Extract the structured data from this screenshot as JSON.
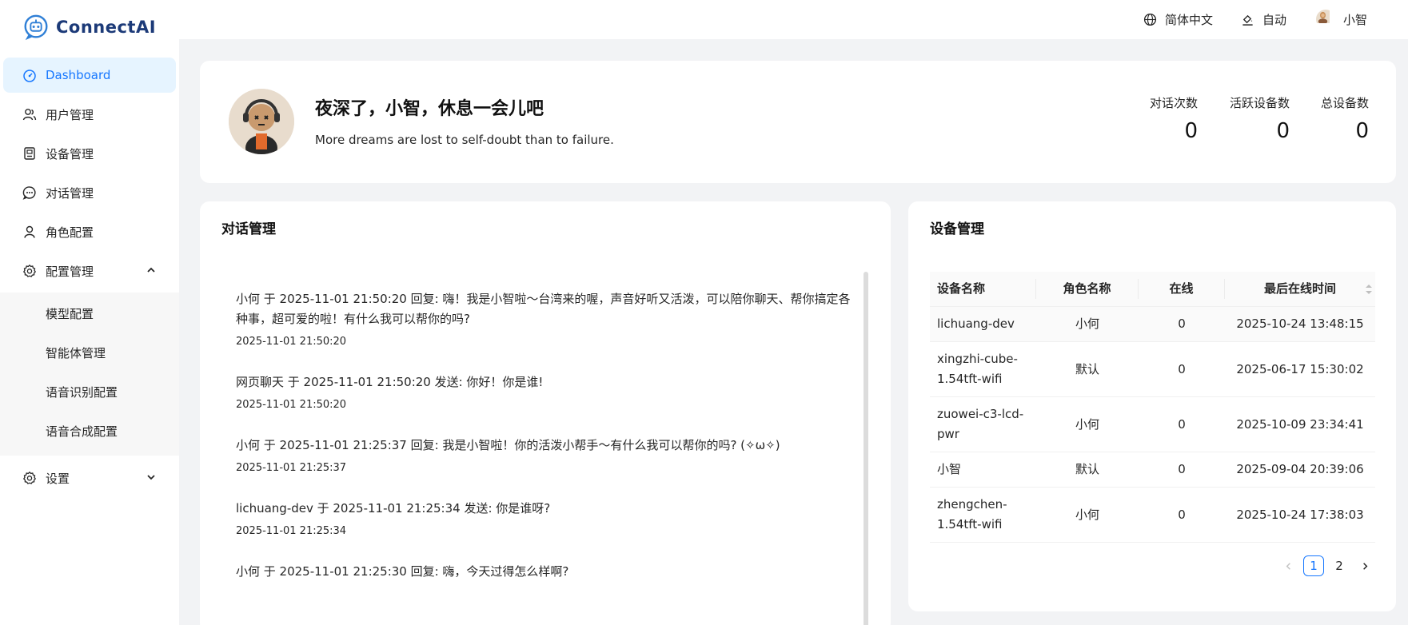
{
  "brand": {
    "name": "ConnectAI"
  },
  "sidebar": {
    "items": [
      {
        "label": "Dashboard",
        "icon": "dashboard-icon",
        "active": true
      },
      {
        "label": "用户管理",
        "icon": "users-icon"
      },
      {
        "label": "设备管理",
        "icon": "device-icon"
      },
      {
        "label": "对话管理",
        "icon": "chat-icon"
      },
      {
        "label": "角色配置",
        "icon": "user-icon"
      },
      {
        "label": "配置管理",
        "icon": "gear-icon",
        "expanded": true
      }
    ],
    "submenu": [
      {
        "label": "模型配置"
      },
      {
        "label": "智能体管理"
      },
      {
        "label": "语音识别配置"
      },
      {
        "label": "语音合成配置"
      }
    ],
    "settings": {
      "label": "设置",
      "icon": "gear-icon"
    }
  },
  "header": {
    "language": "简体中文",
    "theme": "自动",
    "user": "小智"
  },
  "welcome": {
    "title": "夜深了，小智，休息一会儿吧",
    "subtitle": "More dreams are lost to self-doubt than to failure.",
    "stats": [
      {
        "label": "对话次数",
        "value": "0"
      },
      {
        "label": "活跃设备数",
        "value": "0"
      },
      {
        "label": "总设备数",
        "value": "0"
      }
    ]
  },
  "conversations": {
    "title": "对话管理",
    "messages": [
      {
        "text": "小何 于 2025-11-01 21:50:20 回复: 嗨！我是小智啦～台湾来的喔，声音好听又活泼，可以陪你聊天、帮你搞定各种事，超可爱的啦！有什么我可以帮你的吗?",
        "time": "2025-11-01 21:50:20"
      },
      {
        "text": "网页聊天 于 2025-11-01 21:50:20 发送: 你好！你是谁!",
        "time": "2025-11-01 21:50:20"
      },
      {
        "text": "小何 于 2025-11-01 21:25:37 回复: 我是小智啦！你的活泼小帮手～有什么我可以帮你的吗? (✧ω✧)",
        "time": "2025-11-01 21:25:37"
      },
      {
        "text": "lichuang-dev 于 2025-11-01 21:25:34 发送: 你是谁呀?",
        "time": "2025-11-01 21:25:34"
      },
      {
        "text": "小何 于 2025-11-01 21:25:30 回复: 嗨，今天过得怎么样啊?",
        "time": ""
      }
    ]
  },
  "devices": {
    "title": "设备管理",
    "columns": [
      "设备名称",
      "角色名称",
      "在线",
      "最后在线时间"
    ],
    "rows": [
      {
        "name": "lichuang-dev",
        "role": "小何",
        "online": "0",
        "last": "2025-10-24 13:48:15"
      },
      {
        "name": "xingzhi-cube-1.54tft-wifi",
        "role": "默认",
        "online": "0",
        "last": "2025-06-17 15:30:02"
      },
      {
        "name": "zuowei-c3-lcd-pwr",
        "role": "小何",
        "online": "0",
        "last": "2025-10-09 23:34:41"
      },
      {
        "name": "小智",
        "role": "默认",
        "online": "0",
        "last": "2025-09-04 20:39:06"
      },
      {
        "name": "zhengchen-1.54tft-wifi",
        "role": "小何",
        "online": "0",
        "last": "2025-10-24 17:38:03"
      }
    ],
    "pagination": {
      "current": "1",
      "pages": [
        "1",
        "2"
      ]
    }
  },
  "colors": {
    "accent": "#1677ff",
    "active_bg": "#e6f4ff",
    "brand": "#1c3a78"
  }
}
